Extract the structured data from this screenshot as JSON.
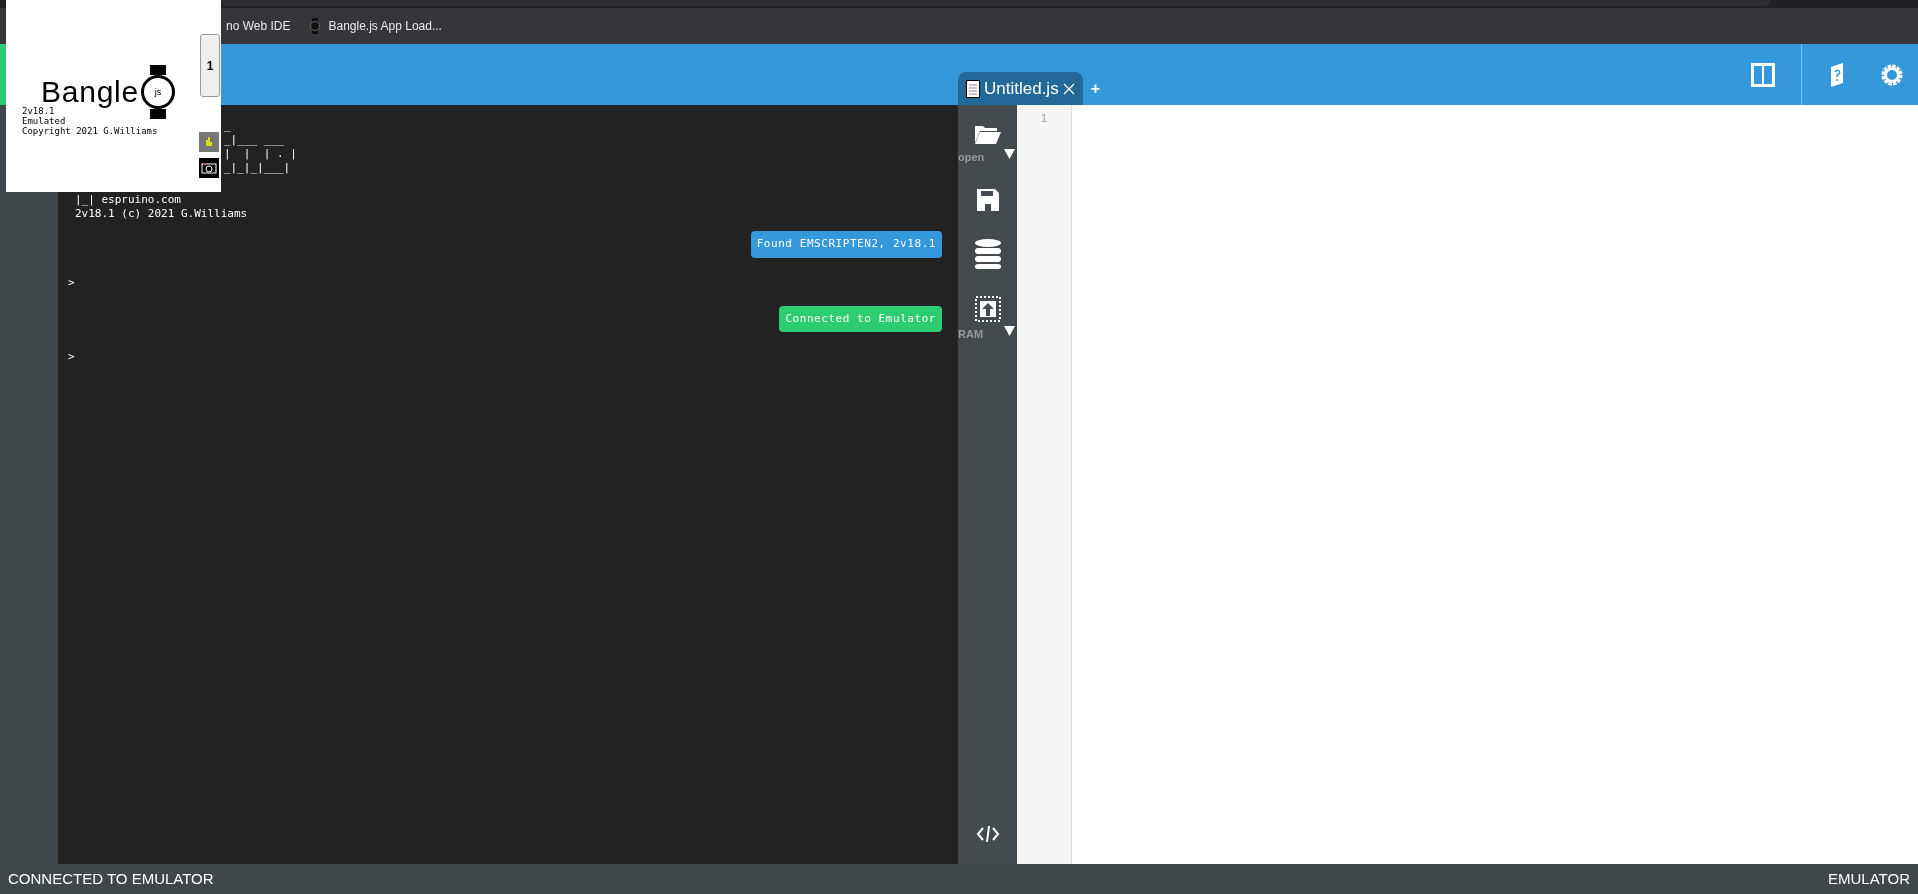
{
  "bookmarks": [
    {
      "label": "no Web IDE",
      "kind": "plain"
    },
    {
      "label": "Bangle.js App Load...",
      "kind": "watch"
    }
  ],
  "emulator": {
    "logo_text": "Bangle",
    "logo_badge": "js",
    "lines": [
      "2v18.1",
      "Emulated",
      "Copyright 2021 G.Williams"
    ],
    "button": "1"
  },
  "terminal": {
    "ascii": [
      "_",
      "_|___ ___",
      "|  |  | . |",
      "_|_|_|___|"
    ],
    "lines": [
      {
        "kind": "text",
        "text": "|_| espruino.com"
      },
      {
        "kind": "text",
        "text": "2v18.1 (c) 2021 G.Williams"
      },
      {
        "kind": "bubble",
        "text": "Found EMSCRIPTEN2, 2v18.1",
        "color": "#3498db"
      },
      {
        "kind": "prompt",
        "text": ">"
      },
      {
        "kind": "bubble",
        "text": "Connected to Emulator",
        "color": "#2ecc71"
      },
      {
        "kind": "prompt",
        "text": ">"
      }
    ]
  },
  "tabs": [
    {
      "label": "Untitled.js",
      "selected": true
    }
  ],
  "new_tab": "+",
  "toolbar": [
    {
      "kind": "open",
      "label": "open"
    },
    {
      "kind": "save"
    },
    {
      "kind": "storage"
    },
    {
      "kind": "upload",
      "label": "RAM"
    }
  ],
  "editor": {
    "line_numbers": [
      "1"
    ]
  },
  "status_bar": {
    "left": "CONNECTED TO EMULATOR",
    "right": "EMULATOR"
  }
}
